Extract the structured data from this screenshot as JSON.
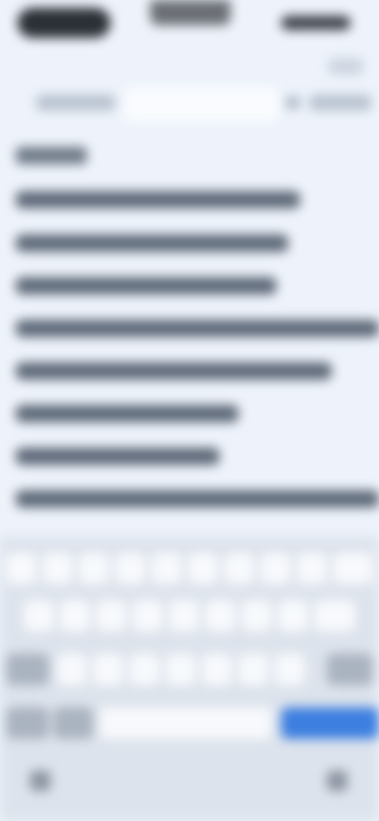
{
  "status_bar": {},
  "header": {
    "title": ""
  },
  "tabs": [
    {
      "label": ""
    },
    {
      "label": ""
    },
    {
      "label": ""
    }
  ],
  "suggestions": {
    "heading": "",
    "items": [
      {
        "label": ""
      },
      {
        "label": ""
      },
      {
        "label": ""
      },
      {
        "label": ""
      },
      {
        "label": ""
      },
      {
        "label": ""
      },
      {
        "label": ""
      },
      {
        "label": ""
      }
    ]
  },
  "keyboard": {
    "space_label": "",
    "return_label": "",
    "accent_color": "#3d7fe0"
  }
}
